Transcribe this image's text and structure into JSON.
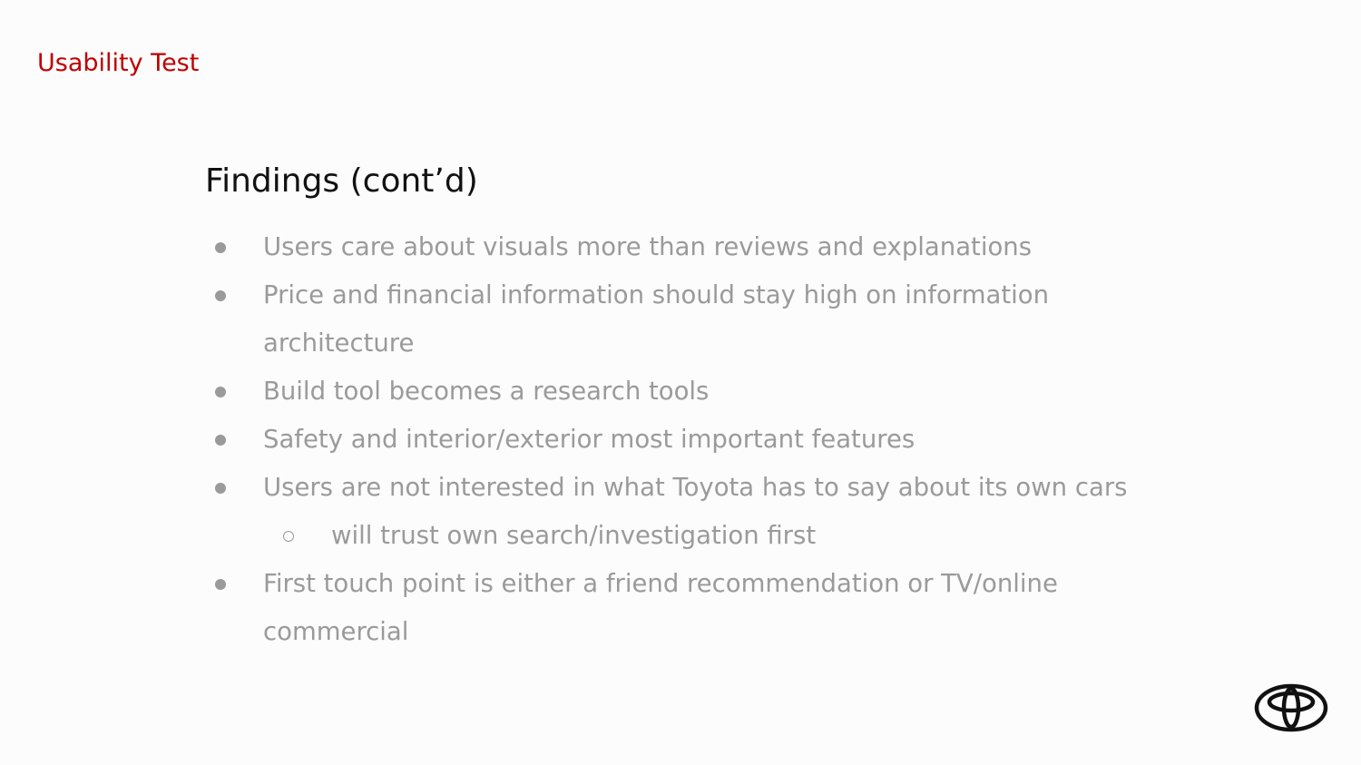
{
  "header": {
    "section_title": "Usability Test"
  },
  "main": {
    "heading": "Findings (cont’d)",
    "findings": [
      {
        "text": "Users care about visuals more than reviews and explanations",
        "level": 1
      },
      {
        "text": "Price and financial information should stay high on information",
        "level": 1
      },
      {
        "text": "architecture",
        "level": 0
      },
      {
        "text": "Build tool becomes a research tools",
        "level": 1
      },
      {
        "text": "Safety and interior/exterior most important features",
        "level": 1
      },
      {
        "text": "Users are not interested in what Toyota has to say about its own cars",
        "level": 1
      },
      {
        "text": "will trust own search/investigation first",
        "level": 2
      },
      {
        "text": "First touch point is either a friend recommendation or TV/online",
        "level": 1
      },
      {
        "text": "commercial",
        "level": 0
      }
    ]
  },
  "footer": {
    "logo_icon": "toyota-logo-icon"
  },
  "colors": {
    "accent": "#c00000",
    "heading": "#111111",
    "body_text": "#9a9a9a",
    "bullet": "#9a9a9a",
    "logo": "#111111",
    "background": "#fcfcfc"
  }
}
